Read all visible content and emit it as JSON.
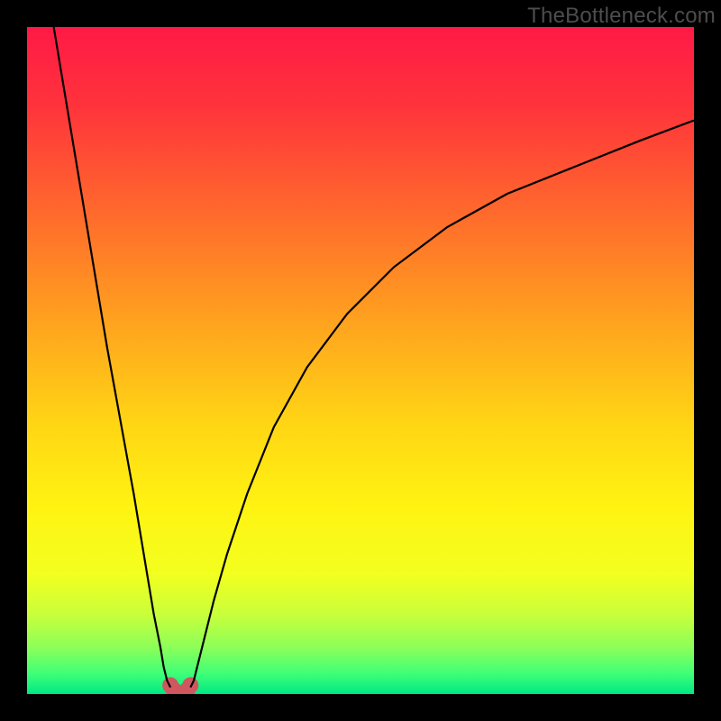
{
  "watermark": "TheBottleneck.com",
  "colors": {
    "gradient_stops": [
      {
        "offset": 0.0,
        "color": "#ff1946"
      },
      {
        "offset": 0.12,
        "color": "#ff343b"
      },
      {
        "offset": 0.28,
        "color": "#ff6a2c"
      },
      {
        "offset": 0.45,
        "color": "#ffa51e"
      },
      {
        "offset": 0.6,
        "color": "#ffd714"
      },
      {
        "offset": 0.72,
        "color": "#fff312"
      },
      {
        "offset": 0.82,
        "color": "#f3ff1f"
      },
      {
        "offset": 0.88,
        "color": "#c9ff3a"
      },
      {
        "offset": 0.93,
        "color": "#8dff58"
      },
      {
        "offset": 0.97,
        "color": "#3dff78"
      },
      {
        "offset": 1.0,
        "color": "#00e884"
      }
    ],
    "curve_stroke": "#000000",
    "marker_stroke": "#d0575f",
    "frame_bg": "#000000"
  },
  "chart_data": {
    "type": "line",
    "title": "",
    "xlabel": "",
    "ylabel": "",
    "xlim": [
      0,
      100
    ],
    "ylim": [
      0,
      100
    ],
    "series": [
      {
        "name": "left-branch",
        "x": [
          4,
          6,
          8,
          10,
          12,
          14,
          16,
          18,
          19,
          20,
          20.5,
          21,
          21.5
        ],
        "y": [
          100,
          88,
          76,
          64,
          52,
          41,
          30,
          18,
          12,
          7,
          4,
          2,
          1
        ]
      },
      {
        "name": "right-branch",
        "x": [
          24.5,
          25,
          25.5,
          26,
          27,
          28,
          30,
          33,
          37,
          42,
          48,
          55,
          63,
          72,
          82,
          92,
          100
        ],
        "y": [
          1,
          2,
          4,
          6,
          10,
          14,
          21,
          30,
          40,
          49,
          57,
          64,
          70,
          75,
          79,
          83,
          86
        ]
      },
      {
        "name": "valley-floor",
        "x": [
          21.5,
          22,
          22.5,
          23,
          23.5,
          24,
          24.5
        ],
        "y": [
          1,
          0.3,
          0,
          0,
          0,
          0.3,
          1
        ]
      }
    ],
    "markers": {
      "name": "valley-markers",
      "x": [
        21.5,
        22.0,
        22.5,
        23.5,
        24.0,
        24.5
      ],
      "y": [
        1.3,
        0.6,
        0.2,
        0.2,
        0.6,
        1.3
      ]
    }
  }
}
